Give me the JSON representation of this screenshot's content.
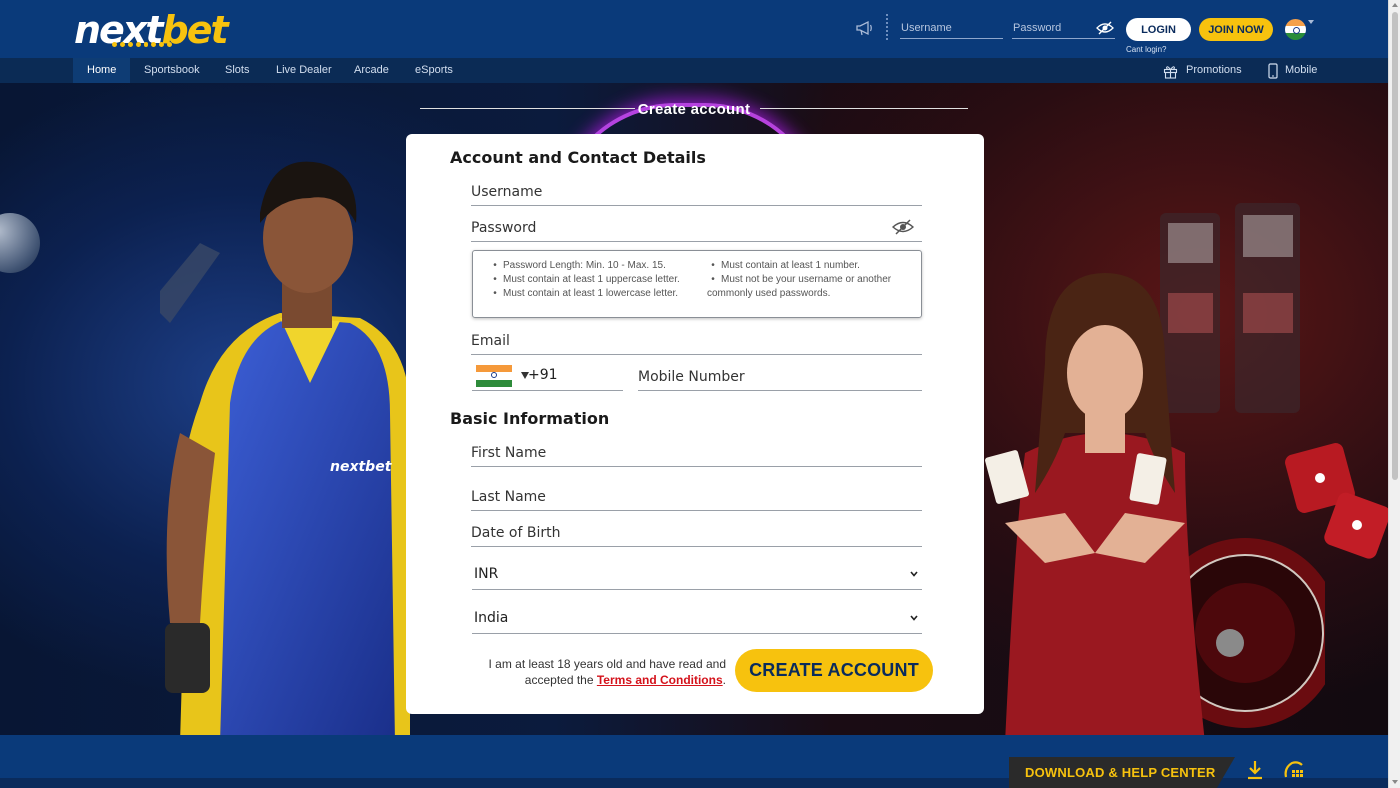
{
  "header": {
    "logo_next": "next",
    "logo_bet": "bet",
    "username_placeholder": "Username",
    "password_placeholder": "Password",
    "login_label": "LOGIN",
    "join_label": "JOIN NOW",
    "cant_login": "Cant login?",
    "country_flag": "india-flag-icon"
  },
  "nav": {
    "items": [
      {
        "label": "Home",
        "active": true
      },
      {
        "label": "Sportsbook"
      },
      {
        "label": "Slots"
      },
      {
        "label": "Live Dealer"
      },
      {
        "label": "Arcade"
      },
      {
        "label": "eSports"
      }
    ],
    "promotions": "Promotions",
    "mobile": "Mobile"
  },
  "page": {
    "title": "Create account"
  },
  "form": {
    "section_account": "Account and Contact Details",
    "username": "Username",
    "password": "Password",
    "password_rules_left": [
      "Password Length: Min. 10 - Max. 15.",
      "Must contain at least 1 uppercase letter.",
      "Must contain at least 1 lowercase letter."
    ],
    "password_rules_right_1": "Must contain at least 1 number.",
    "password_rules_right_2": "Must not be your username or another",
    "password_rules_right_2b": "commonly used passwords.",
    "email": "Email",
    "phone_code": "+91",
    "mobile": "Mobile Number",
    "section_basic": "Basic Information",
    "first_name": "First Name",
    "last_name": "Last Name",
    "dob": "Date of Birth",
    "currency": "INR",
    "country": "India",
    "terms_text_1": "I am at least 18 years old and have read and",
    "terms_text_2": "accepted the",
    "terms_link": "Terms and Conditions",
    "terms_period": ".",
    "create_button": "CREATE ACCOUNT"
  },
  "footer": {
    "help_center": "DOWNLOAD & HELP CENTER"
  },
  "colors": {
    "brand_blue": "#0a3a7a",
    "accent_yellow": "#f7c20e",
    "link_red": "#d4121b"
  }
}
